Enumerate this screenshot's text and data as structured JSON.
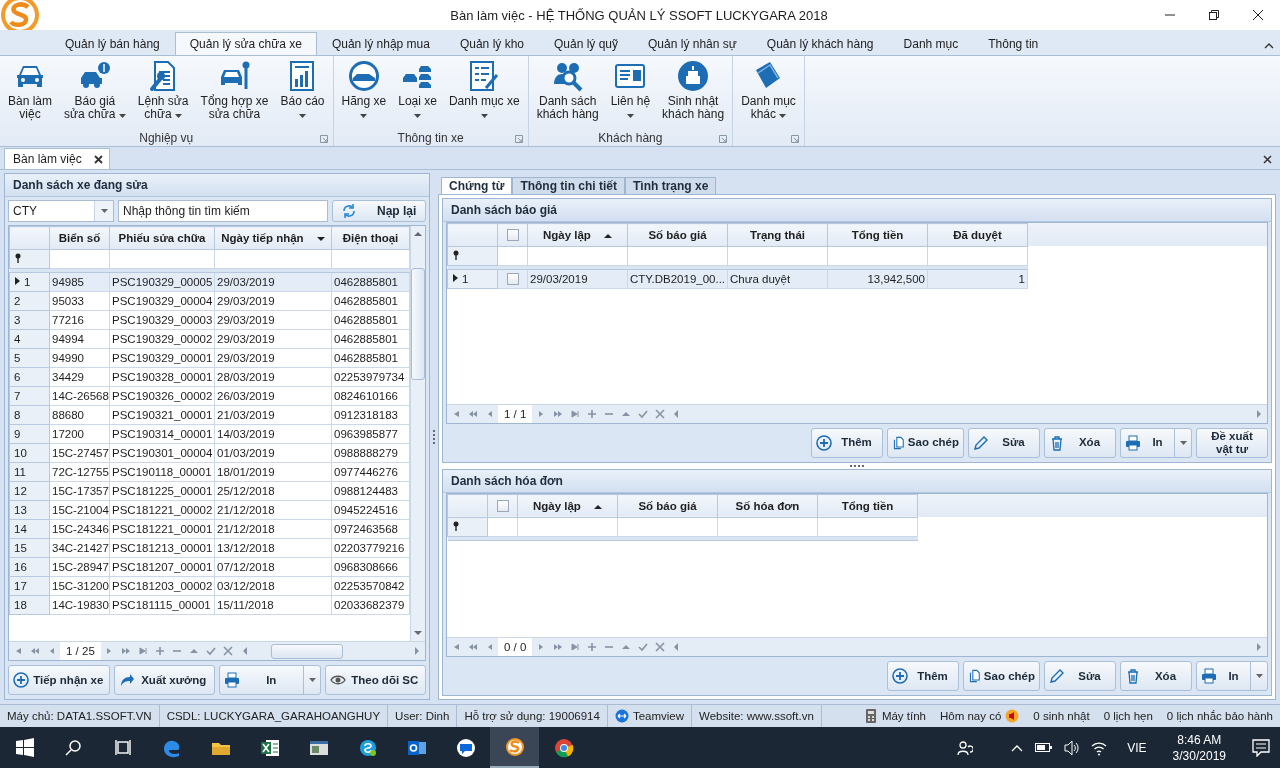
{
  "window": {
    "title": "Bàn làm việc - HỆ THỐNG QUẢN LÝ SSOFT LUCKYGARA 2018"
  },
  "ribbon": {
    "tabs": [
      {
        "label": "Quản lý bán hàng",
        "selected": false
      },
      {
        "label": "Quản lý sửa chữa xe",
        "selected": true
      },
      {
        "label": "Quản lý nhập mua",
        "selected": false
      },
      {
        "label": "Quản lý kho",
        "selected": false
      },
      {
        "label": "Quản lý quỹ",
        "selected": false
      },
      {
        "label": "Quản lý nhân sự",
        "selected": false
      },
      {
        "label": "Quản lý khách hàng",
        "selected": false
      },
      {
        "label": "Danh mục",
        "selected": false
      },
      {
        "label": "Thông tin",
        "selected": false
      }
    ],
    "groups": [
      {
        "label": "Nghiệp vụ",
        "buttons": [
          {
            "label": "Bàn làm\nviệc",
            "dropdown": false
          },
          {
            "label": "Báo giá\nsửa chữa",
            "dropdown": true
          },
          {
            "label": "Lệnh sửa\nchữa",
            "dropdown": true
          },
          {
            "label": "Tổng hợp xe\nsửa chữa",
            "dropdown": false
          },
          {
            "label": "Báo cáo",
            "dropdown": true
          }
        ]
      },
      {
        "label": "Thông tin xe",
        "buttons": [
          {
            "label": "Hãng xe",
            "dropdown": true
          },
          {
            "label": "Loại xe",
            "dropdown": true
          },
          {
            "label": "Danh mục xe",
            "dropdown": true
          }
        ]
      },
      {
        "label": "Khách hàng",
        "buttons": [
          {
            "label": "Danh sách\nkhách hàng",
            "dropdown": false
          },
          {
            "label": "Liên hệ",
            "dropdown": true
          },
          {
            "label": "Sinh nhật\nkhách hàng",
            "dropdown": false
          }
        ]
      },
      {
        "buttons": [
          {
            "label": "Danh mục\nkhác",
            "dropdown": true
          }
        ]
      }
    ]
  },
  "doc_tabs": [
    {
      "label": "Bàn làm việc",
      "selected": true
    }
  ],
  "left_panel": {
    "title": "Danh sách xe đang sửa",
    "branch_select": {
      "value": "CTY"
    },
    "search_field": {
      "placeholder": "Nhập thông tin tìm kiếm"
    },
    "reload_button": "Nạp lại",
    "table": {
      "columns": [
        {
          "label": "Biển số",
          "sorted_ascending": false,
          "sorted_descending": false
        },
        {
          "label": "Phiếu sửa chữa",
          "sorted_ascending": false,
          "sorted_descending": false
        },
        {
          "label": "Ngày tiếp nhận",
          "sorted_ascending": false,
          "sorted_descending": true
        },
        {
          "label": "Điện thoại",
          "sorted_ascending": false,
          "sorted_descending": false
        }
      ],
      "rows": [
        {
          "number": "1",
          "selected": true,
          "cells": [
            "94985",
            "PSC190329_00005",
            "29/03/2019",
            "0462885801"
          ]
        },
        {
          "number": "2",
          "selected": false,
          "cells": [
            "95033",
            "PSC190329_00004",
            "29/03/2019",
            "0462885801"
          ]
        },
        {
          "number": "3",
          "selected": false,
          "cells": [
            "77216",
            "PSC190329_00003",
            "29/03/2019",
            "0462885801"
          ]
        },
        {
          "number": "4",
          "selected": false,
          "cells": [
            "94994",
            "PSC190329_00002",
            "29/03/2019",
            "0462885801"
          ]
        },
        {
          "number": "5",
          "selected": false,
          "cells": [
            "94990",
            "PSC190329_00001",
            "29/03/2019",
            "0462885801"
          ]
        },
        {
          "number": "6",
          "selected": false,
          "cells": [
            "34429",
            "PSC190328_00001",
            "28/03/2019",
            "02253979734"
          ]
        },
        {
          "number": "7",
          "selected": false,
          "cells": [
            "14C-26568",
            "PSC190326_00002",
            "26/03/2019",
            "0824610166"
          ]
        },
        {
          "number": "8",
          "selected": false,
          "cells": [
            "88680",
            "PSC190321_00001",
            "21/03/2019",
            "0912318183"
          ]
        },
        {
          "number": "9",
          "selected": false,
          "cells": [
            "17200",
            "PSC190314_00001",
            "14/03/2019",
            "0963985877"
          ]
        },
        {
          "number": "10",
          "selected": false,
          "cells": [
            "15C-27457",
            "PSC190301_00004",
            "01/03/2019",
            "0988888279"
          ]
        },
        {
          "number": "11",
          "selected": false,
          "cells": [
            "72C-12755",
            "PSC190118_00001",
            "18/01/2019",
            "0977446276"
          ]
        },
        {
          "number": "12",
          "selected": false,
          "cells": [
            "15C-17357",
            "PSC181225_00001",
            "25/12/2018",
            "0988124483"
          ]
        },
        {
          "number": "13",
          "selected": false,
          "cells": [
            "15C-21004",
            "PSC181221_00002",
            "21/12/2018",
            "0945224516"
          ]
        },
        {
          "number": "14",
          "selected": false,
          "cells": [
            "15C-24346",
            "PSC181221_00001",
            "21/12/2018",
            "0972463568"
          ]
        },
        {
          "number": "15",
          "selected": false,
          "cells": [
            "34C-21427",
            "PSC181213_00001",
            "13/12/2018",
            "02203779216"
          ]
        },
        {
          "number": "16",
          "selected": false,
          "cells": [
            "15C-28947",
            "PSC181207_00001",
            "07/12/2018",
            "0968308666"
          ]
        },
        {
          "number": "17",
          "selected": false,
          "cells": [
            "15C-31200",
            "PSC181203_00002",
            "03/12/2018",
            "02253570842"
          ]
        },
        {
          "number": "18",
          "selected": false,
          "cells": [
            "14C-19830",
            "PSC181115_00001",
            "15/11/2018",
            "02033682379"
          ]
        }
      ],
      "pager": "1 / 25"
    },
    "buttons": [
      {
        "kind": "add",
        "label": "Tiếp nhận xe"
      },
      {
        "kind": "export",
        "label": "Xuất xưởng"
      },
      {
        "kind": "print",
        "label": "In",
        "dropdown": true
      },
      {
        "kind": "view",
        "label": "Theo dõi SC"
      }
    ]
  },
  "right_panel": {
    "tabs": [
      {
        "label": "Chứng từ",
        "selected": true
      },
      {
        "label": "Thông tin chi tiết",
        "selected": false
      },
      {
        "label": "Tình trạng xe",
        "selected": false
      }
    ],
    "quotes": {
      "title": "Danh sách báo giá",
      "table": {
        "select_all_checked": false,
        "columns": [
          {
            "label": "Ngày lập",
            "sorted_ascending": true,
            "sorted_descending": false
          },
          {
            "label": "Số báo giá",
            "sorted_ascending": false,
            "sorted_descending": false
          },
          {
            "label": "Trạng thái",
            "sorted_ascending": false,
            "sorted_descending": false
          },
          {
            "label": "Tổng tiền",
            "sorted_ascending": false,
            "sorted_descending": false
          },
          {
            "label": "Đã duyệt",
            "sorted_ascending": false,
            "sorted_descending": false
          }
        ],
        "rows": [
          {
            "number": "1",
            "selected": true,
            "checked": false,
            "cells": [
              "29/03/2019",
              "CTY.DB2019_00...",
              "Chưa duyệt",
              "13,942,500",
              "1"
            ]
          }
        ],
        "pager": "1 / 1"
      },
      "buttons": [
        {
          "kind": "add",
          "label": "Thêm"
        },
        {
          "kind": "copy",
          "label": "Sao chép"
        },
        {
          "kind": "edit",
          "label": "Sửa"
        },
        {
          "kind": "delete",
          "label": "Xóa"
        },
        {
          "kind": "print",
          "label": "In",
          "dropdown": true
        },
        {
          "kind": "plain",
          "label": "Đề xuất\nvật tư"
        }
      ]
    },
    "invoices": {
      "title": "Danh sách hóa đơn",
      "table": {
        "select_all_checked": false,
        "columns": [
          {
            "label": "Ngày lập",
            "sorted_ascending": true,
            "sorted_descending": false
          },
          {
            "label": "Số báo giá",
            "sorted_ascending": false,
            "sorted_descending": false
          },
          {
            "label": "Số hóa đơn",
            "sorted_ascending": false,
            "sorted_descending": false
          },
          {
            "label": "Tổng tiền",
            "sorted_ascending": false,
            "sorted_descending": false
          }
        ],
        "pager": "0 / 0"
      },
      "buttons": [
        {
          "kind": "add",
          "label": "Thêm"
        },
        {
          "kind": "copy",
          "label": "Sao chép"
        },
        {
          "kind": "edit",
          "label": "Sửa"
        },
        {
          "kind": "delete",
          "label": "Xóa"
        },
        {
          "kind": "print",
          "label": "In",
          "dropdown": true
        }
      ]
    }
  },
  "status_bar": {
    "left": [
      {
        "kind": "text",
        "text": "Máy chủ: DATA1.SSOFT.VN"
      },
      {
        "kind": "text",
        "text": "CSDL: LUCKYGARA_GARAHOANGHUY"
      },
      {
        "kind": "text",
        "text": "User: Dinh"
      },
      {
        "kind": "text",
        "text": "Hỗ trợ sử dụng: 19006914"
      },
      {
        "kind": "teamview",
        "text": "Teamview"
      },
      {
        "kind": "text",
        "text": "Website: www.ssoft.vn"
      }
    ],
    "right": [
      {
        "kind": "calculator",
        "text": "Máy tính"
      },
      {
        "kind": "notice",
        "text": "Hôm nay có"
      },
      {
        "kind": "text",
        "text": "0 sinh nhật"
      },
      {
        "kind": "text",
        "text": "0 lịch hẹn"
      },
      {
        "kind": "text",
        "text": "0 lịch nhắc bảo hành"
      }
    ]
  },
  "taskbar": {
    "apps": [
      {
        "kind": "edge",
        "selected": false
      },
      {
        "kind": "folder",
        "selected": false
      },
      {
        "kind": "excel",
        "selected": false
      },
      {
        "kind": "window",
        "selected": false
      },
      {
        "kind": "skype",
        "selected": false
      },
      {
        "kind": "outlook",
        "selected": false
      },
      {
        "kind": "chat",
        "selected": false
      },
      {
        "kind": "ssoft",
        "selected": true
      },
      {
        "kind": "chrome",
        "selected": false
      }
    ],
    "language": "VIE",
    "time": "8:46 AM",
    "date": "3/30/2019"
  }
}
